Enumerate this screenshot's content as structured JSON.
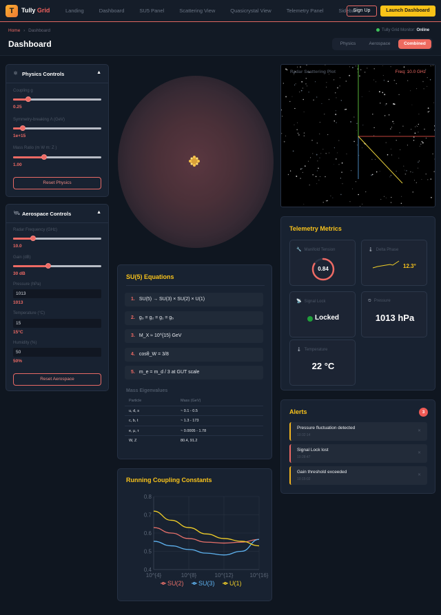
{
  "app": {
    "logo_letter": "T",
    "brand_first": "Tully",
    "brand_second": "Grid"
  },
  "nav": {
    "links": [
      "Landing",
      "Dashboard",
      "SU5 Panel",
      "Scattering View",
      "Quasicrystal View",
      "Telemetry Panel",
      "Sidebar"
    ],
    "signup": "Sign Up",
    "launch": "Launch Dashboard"
  },
  "header": {
    "breadcrumb_home": "Home",
    "breadcrumb_sep": "›",
    "breadcrumb_current": "Dashboard",
    "title": "Dashboard",
    "monitor_label": "Tully Grid Monitor:",
    "monitor_status": "Online",
    "tabs": [
      "Physics",
      "Aerospace",
      "Combined"
    ],
    "active_tab": "Combined"
  },
  "physics": {
    "title": "Physics Controls",
    "icon": "atom-icon",
    "sliders": [
      {
        "label": "Coupling g",
        "value": "0.25",
        "fraction": 0.17
      },
      {
        "label": "Symmetry-breaking Λ (GeV)",
        "value": "1e+15",
        "fraction": 0.11
      },
      {
        "label": "Mass Ratio (m      W      m:      Z      )",
        "value": "1.00",
        "fraction": 0.35
      }
    ],
    "reset": "Reset Physics"
  },
  "aerospace": {
    "title": "Aerospace Controls",
    "icon": "satellite-icon",
    "sliders": [
      {
        "label": "Radar Frequency (GHz)",
        "value": "10.0",
        "fraction": 0.23
      },
      {
        "label": "Gain (dB)",
        "value": "30 dB",
        "fraction": 0.4
      }
    ],
    "inputs": [
      {
        "label": "Pressure (hPa)",
        "field": "1013",
        "value": "1013"
      },
      {
        "label": "Temperature (°C)",
        "field": "15",
        "value": "15°C"
      },
      {
        "label": "Humidity (%)",
        "field": "50",
        "value": "50%"
      }
    ],
    "reset": "Reset Aerospace"
  },
  "radar": {
    "title": "Radar Scattering Plot",
    "freq": "Freq: 10.0 GHz"
  },
  "su5": {
    "title": "SU(5) Equations",
    "equations": [
      {
        "n": "1.",
        "text": "SU(5) → SU(3) × SU(2) × U(1)"
      },
      {
        "n": "2.",
        "text": "g₃ = g₂ = g₁ = g₅"
      },
      {
        "n": "3.",
        "text": "M_X ≈ 10^{15} GeV"
      },
      {
        "n": "4.",
        "text": "cosθ_W = 3/8"
      },
      {
        "n": "5.",
        "text": "m_e = m_d / 3 at GUT scale"
      }
    ],
    "mass_title": "Mass Eigenvalues",
    "headers": [
      "Particle",
      "Mass (GeV)"
    ],
    "rows": [
      [
        "u, d, s",
        "~ 0.1 - 0.5"
      ],
      [
        "c, b, t",
        "~ 1.3 - 173"
      ],
      [
        "e, μ, τ",
        "~ 0.0005 - 1.78"
      ],
      [
        "W, Z",
        "80.4, 91.2"
      ]
    ]
  },
  "telemetry": {
    "title": "Telemetry Metrics",
    "manifold": {
      "label": "Manifold Tension",
      "value": "0.84",
      "fraction": 0.84
    },
    "delta": {
      "label": "Delta Phase",
      "value": "12.3°"
    },
    "signal": {
      "label": "Signal Lock",
      "value": "Locked"
    },
    "pressure": {
      "label": "Pressure",
      "value": "1013 hPa"
    },
    "temperature": {
      "label": "Temperature",
      "value": "22 °C"
    }
  },
  "alerts": {
    "title": "Alerts",
    "count": "3",
    "items": [
      {
        "text": "Pressure fluctuation detected",
        "time": "10:32:14",
        "color": "#f4b51f"
      },
      {
        "text": "Signal Lock lost",
        "time": "10:28:47",
        "color": "#ee6a64"
      },
      {
        "text": "Gain threshold exceeded",
        "time": "10:15:02",
        "color": "#f4b51f"
      }
    ]
  },
  "coupling": {
    "title": "Running Coupling Constants"
  },
  "chart_data": {
    "type": "line",
    "title": "Running Coupling Constants",
    "x": [
      4,
      6,
      8,
      10,
      12,
      14,
      16
    ],
    "x_ticks": [
      "10^{4}",
      "10^{8}",
      "10^{12}",
      "10^{16}"
    ],
    "x_tick_values": [
      4,
      8,
      12,
      16
    ],
    "ylim": [
      0.4,
      0.8
    ],
    "y_ticks": [
      "0.4",
      "0.5",
      "0.6",
      "0.7",
      "0.8"
    ],
    "grid": true,
    "legend_position": "bottom",
    "series": [
      {
        "name": "SU(2)",
        "color": "#e8716a",
        "values": [
          0.63,
          0.6,
          0.57,
          0.55,
          0.545,
          0.55,
          0.565
        ]
      },
      {
        "name": "SU(3)",
        "color": "#5fb3f0",
        "values": [
          0.555,
          0.53,
          0.51,
          0.49,
          0.48,
          0.5,
          0.565
        ]
      },
      {
        "name": "U(1)",
        "color": "#f2cf28",
        "values": [
          0.72,
          0.67,
          0.63,
          0.595,
          0.57,
          0.555,
          0.53
        ]
      }
    ]
  },
  "colors": {
    "accent": "#ee6a64",
    "gold": "#f9c31b",
    "success": "#3ec25a"
  }
}
